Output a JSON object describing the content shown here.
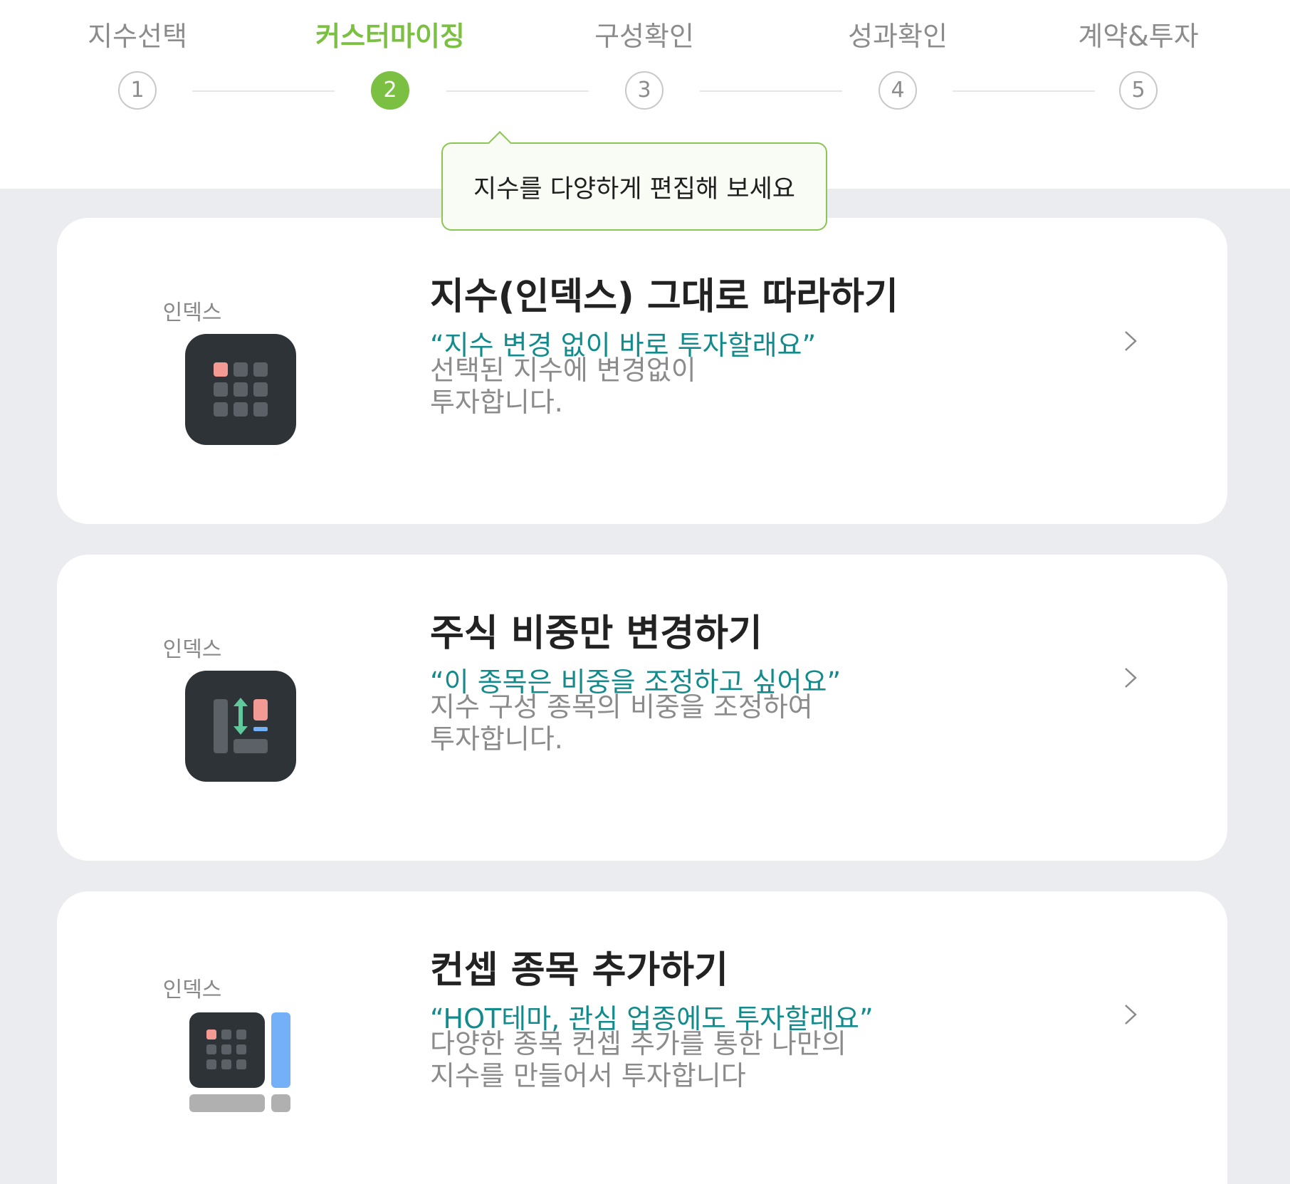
{
  "stepper": {
    "steps": [
      {
        "label": "지수선택",
        "number": "1"
      },
      {
        "label": "커스터마이징",
        "number": "2"
      },
      {
        "label": "구성확인",
        "number": "3"
      },
      {
        "label": "성과확인",
        "number": "4"
      },
      {
        "label": "계약&투자",
        "number": "5"
      }
    ],
    "active_step": 2
  },
  "tooltip": {
    "text": "지수를 다양하게 편집해 보세요"
  },
  "options": [
    {
      "icon_label": "인덱스",
      "icon": "grid-icon",
      "title": "지수(인덱스) 그대로 따라하기",
      "quote": "“지수 변경 없이 바로 투자할래요”",
      "desc_line1": "선택된 지수에 변경없이",
      "desc_line2": "투자합니다."
    },
    {
      "icon_label": "인덱스",
      "icon": "weight-adjust-icon",
      "title": "주식 비중만 변경하기",
      "quote": "“이 종목은 비중을 조정하고 싶어요”",
      "desc_line1": "지수 구성 종목의 비중을 조정하여",
      "desc_line2": "투자합니다."
    },
    {
      "icon_label": "인덱스",
      "icon": "add-concept-icon",
      "title": "컨셉 종목 추가하기",
      "quote": "“HOT테마, 관심 업종에도 투자할래요”",
      "desc_line1": "다양한 종목 컨셉 추가를 통한 나만의",
      "desc_line2": "지수를 만들어서 투자합니다"
    }
  ],
  "colors": {
    "accent_green": "#7cc043",
    "quote_teal": "#138b8d",
    "icon_dark": "#2e3338",
    "icon_pink": "#f29a93",
    "icon_blue": "#74b0f7",
    "icon_mint": "#5fc99c",
    "background_gray": "#ebecef"
  }
}
